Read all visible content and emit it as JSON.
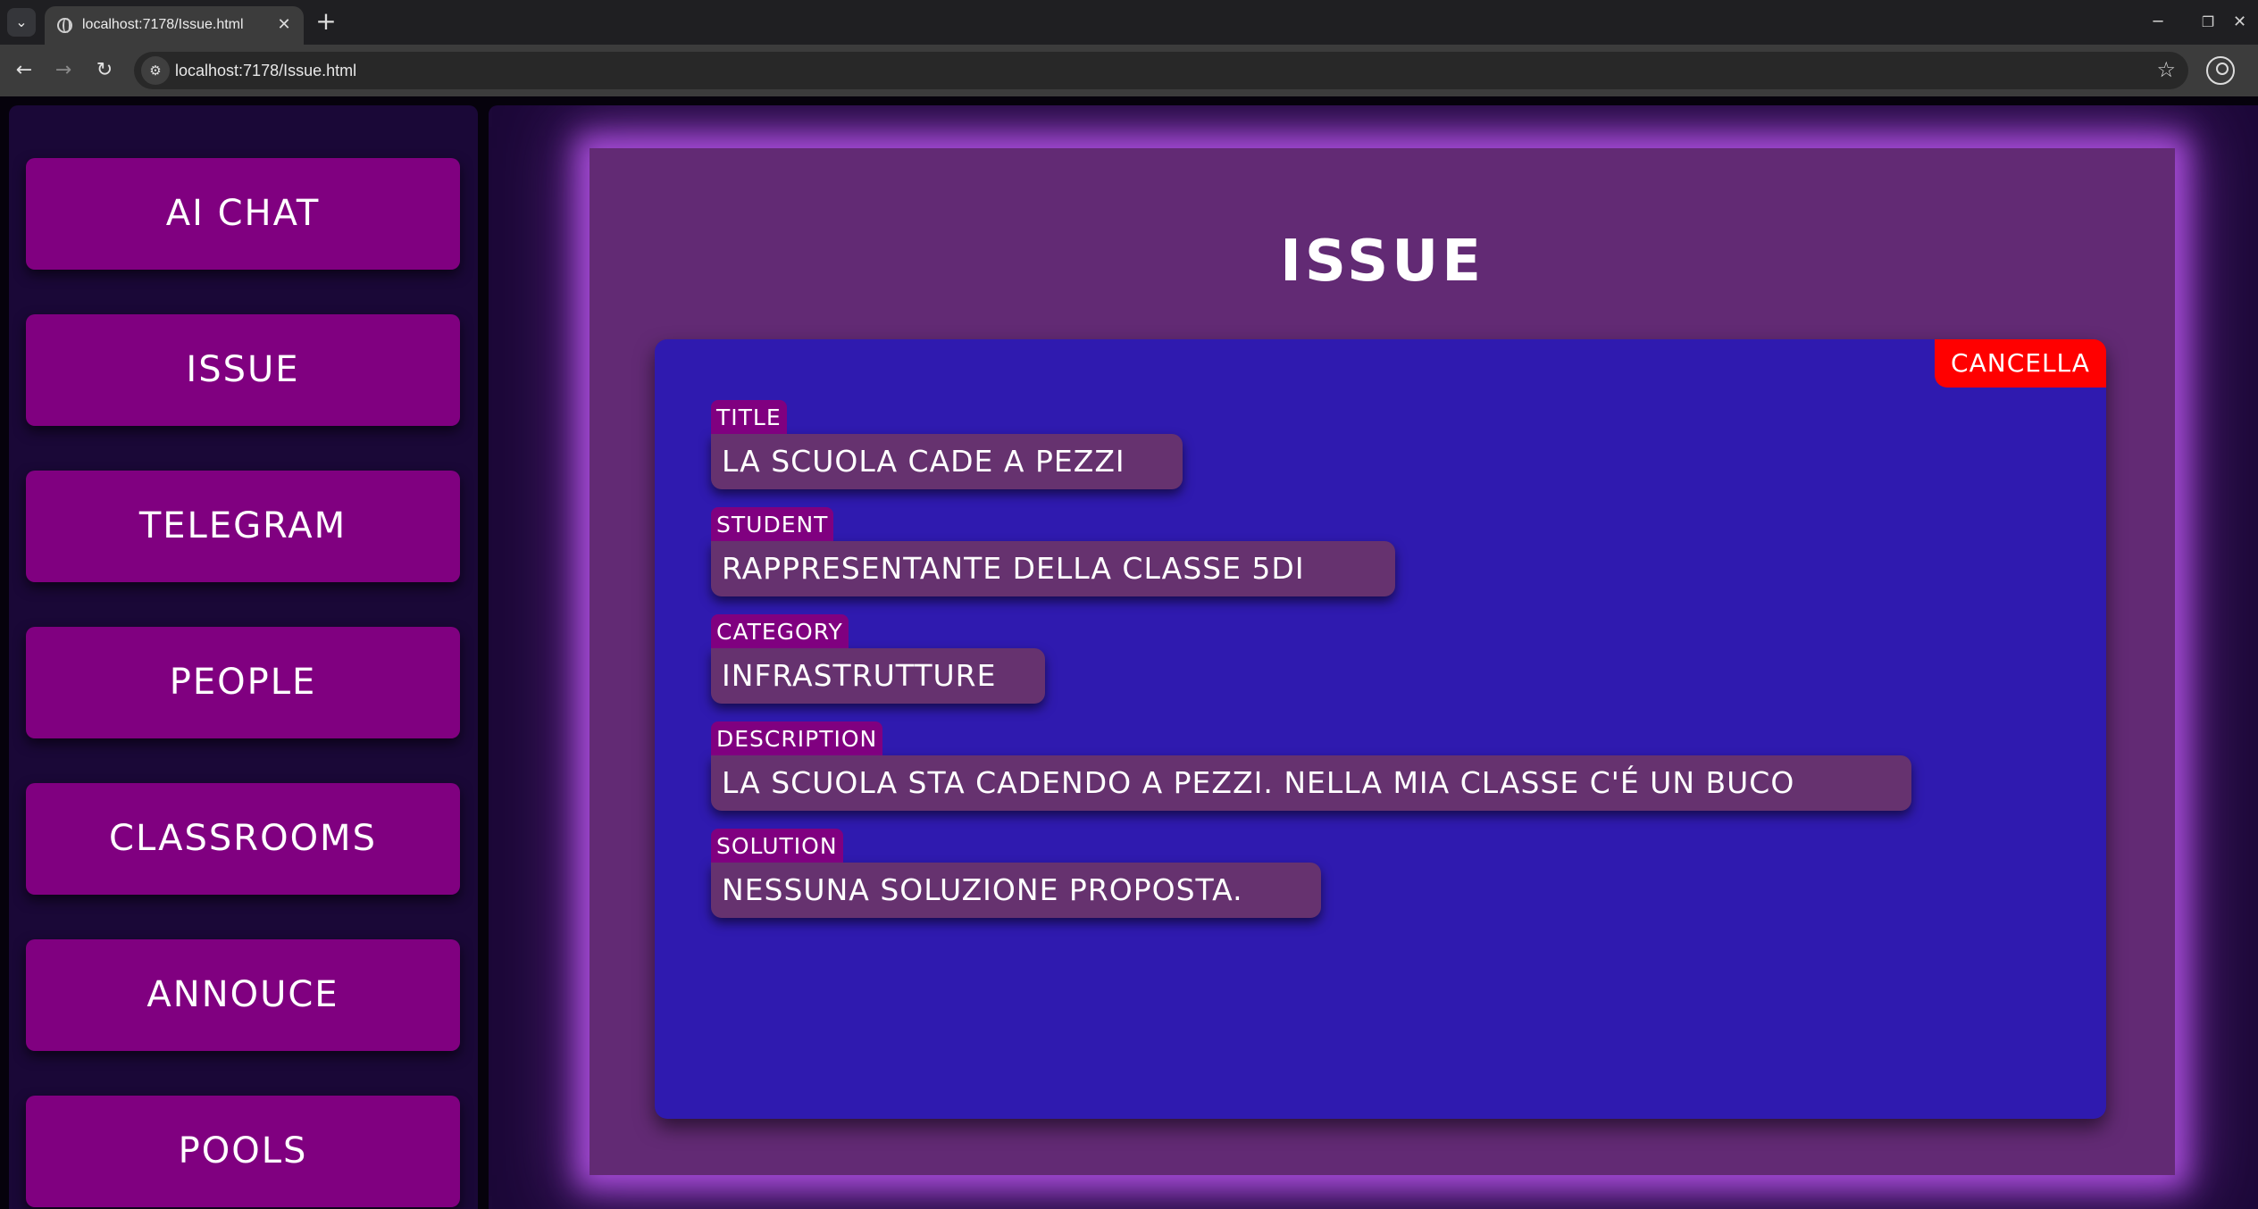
{
  "browser": {
    "tab_title": "localhost:7178/Issue.html",
    "tab_close": "✕",
    "new_tab": "+",
    "url": "localhost:7178/Issue.html",
    "icons": [
      "chevron-down-icon",
      "globe-icon",
      "close-icon",
      "plus-icon",
      "minimize-icon",
      "restore-icon",
      "back-icon",
      "forward-icon",
      "reload-icon",
      "site-settings-icon",
      "star-icon",
      "profile-icon"
    ]
  },
  "sidebar": {
    "items": [
      {
        "label": "AI CHAT"
      },
      {
        "label": "ISSUE"
      },
      {
        "label": "TELEGRAM"
      },
      {
        "label": "PEOPLE"
      },
      {
        "label": "CLASSROOMS"
      },
      {
        "label": "ANNOUCE"
      },
      {
        "label": "POOLS"
      }
    ]
  },
  "main": {
    "title": "ISSUE",
    "card": {
      "cancel_label": "CANCELLA",
      "fields": [
        {
          "label": "TITLE",
          "value": "LA SCUOLA CADE A PEZZI"
        },
        {
          "label": "STUDENT",
          "value": "RAPPRESENTANTE DELLA CLASSE 5DI"
        },
        {
          "label": "CATEGORY",
          "value": "INFRASTRUTTURE"
        },
        {
          "label": "DESCRIPTION",
          "value": "LA SCUOLA STA CADENDO A PEZZI. NELLA MIA CLASSE C'É UN BUCO"
        },
        {
          "label": "SOLUTION",
          "value": "NESSUNA SOLUZIONE PROPOSTA."
        }
      ]
    }
  },
  "colors": {
    "nav_button": "#800080",
    "sidebar_bg": "#1a0837",
    "panel_bg": "#622a74",
    "card_bg": "#2f1aaf",
    "field_value_bg": "#66326f",
    "cancel_button": "#ff0000",
    "glow": "#a54bd6"
  }
}
